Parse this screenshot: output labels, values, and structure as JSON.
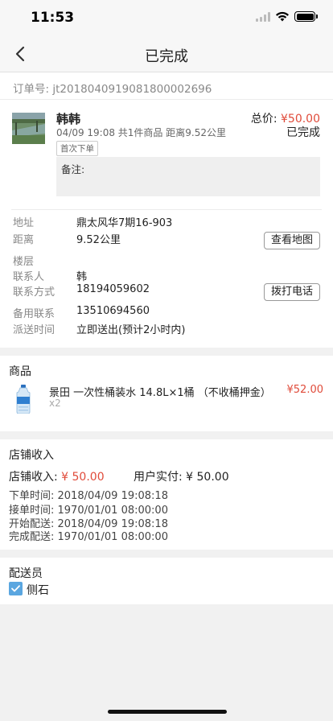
{
  "status_bar": {
    "time": "11:53"
  },
  "nav": {
    "title": "已完成"
  },
  "order": {
    "order_no": "订单号: jt2018040919081800002696",
    "shop_name": "韩韩",
    "meta": "04/09 19:08   共1件商品   距离9.52公里",
    "first_tag": "首次下单",
    "total_label": "总价: ",
    "total_amount": "¥50.00",
    "status": "已完成",
    "remark_label": "备注:"
  },
  "info": {
    "address_label": "地址",
    "address_value": "鼎太风华7期16-903",
    "distance_label": "距离",
    "distance_value": "9.52公里",
    "view_map_button": "查看地图",
    "floor_label": "楼层",
    "contact_label": "联系人",
    "contact_value": "韩",
    "phone_label": "联系方式",
    "phone_value": "18194059602",
    "call_button": "拨打电话",
    "backup_label": "备用联系",
    "backup_value": "13510694560",
    "delivery_label": "派送时间",
    "delivery_value": "立即送出(预计2小时内)"
  },
  "goods": {
    "title": "商品",
    "items": [
      {
        "name": "景田 一次性桶装水 14.8L×1桶 （不收桶押金）",
        "qty": "x2",
        "price": "¥52.00",
        "icon": "water-bottle-icon"
      }
    ]
  },
  "income": {
    "title": "店铺收入",
    "shop_income_label": "店铺收入: ",
    "shop_income_value": "¥ 50.00",
    "paid_label": "用户实付: ",
    "paid_value": "¥ 50.00",
    "times": [
      {
        "label": "下单时间: ",
        "value": "2018/04/09 19:08:18"
      },
      {
        "label": "接单时间: ",
        "value": "1970/01/01 08:00:00"
      },
      {
        "label": "开始配送: ",
        "value": "2018/04/09 19:08:18"
      },
      {
        "label": "完成配送: ",
        "value": "1970/01/01 08:00:00"
      }
    ]
  },
  "courier": {
    "title": "配送员",
    "name": "侧石",
    "checked": true
  },
  "colors": {
    "accent_red": "#e04b3a",
    "checkbox_blue": "#5aa6e0"
  }
}
